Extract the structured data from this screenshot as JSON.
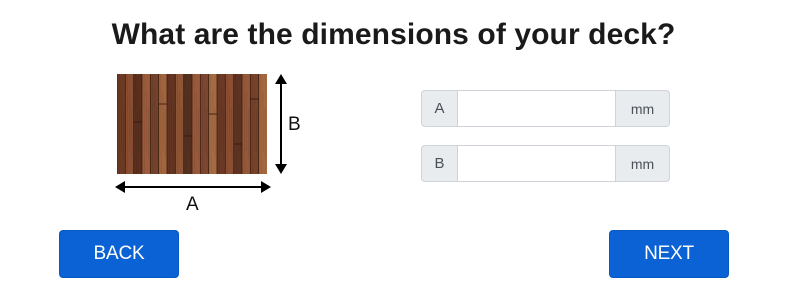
{
  "question": {
    "title": "What are the dimensions of your deck?"
  },
  "figure": {
    "dimension_a_label": "A",
    "dimension_b_label": "B",
    "plank_colors": [
      "#6b3a24",
      "#8a4e33",
      "#5a2f1d",
      "#9c5c3c",
      "#74412a",
      "#a0643f",
      "#633422",
      "#8e5537",
      "#55301f",
      "#9a5a3a",
      "#7c4630",
      "#a66a43",
      "#6a3926",
      "#8b5034",
      "#5f3321",
      "#97583a",
      "#784229",
      "#a3673f"
    ]
  },
  "inputs": {
    "a": {
      "prefix": "A",
      "value": "",
      "unit": "mm"
    },
    "b": {
      "prefix": "B",
      "value": "",
      "unit": "mm"
    }
  },
  "nav": {
    "back_label": "BACK",
    "next_label": "NEXT",
    "accent_color": "#0a62d4"
  }
}
